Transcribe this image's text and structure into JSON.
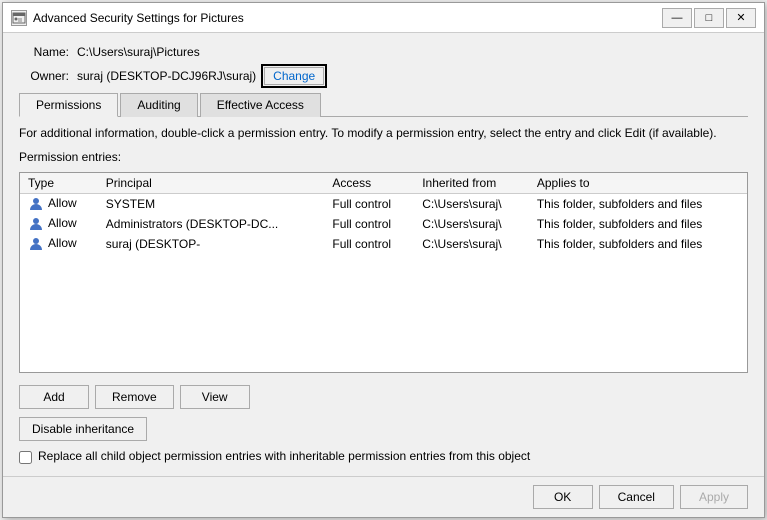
{
  "window": {
    "title": "Advanced Security Settings for Pictures",
    "icon": "🔒"
  },
  "title_buttons": {
    "minimize": "—",
    "maximize": "□",
    "close": "✕"
  },
  "info": {
    "name_label": "Name:",
    "name_value": "C:\\Users\\suraj\\Pictures",
    "owner_label": "Owner:",
    "owner_value": "suraj (DESKTOP-DCJ96RJ\\suraj)",
    "change_label": "Change"
  },
  "tabs": [
    {
      "id": "permissions",
      "label": "Permissions",
      "active": true
    },
    {
      "id": "auditing",
      "label": "Auditing",
      "active": false
    },
    {
      "id": "effective_access",
      "label": "Effective Access",
      "active": false
    }
  ],
  "instruction": "For additional information, double-click a permission entry. To modify a permission entry, select the entry and click Edit (if available).",
  "section_label": "Permission entries:",
  "table": {
    "columns": [
      "Type",
      "Principal",
      "Access",
      "Inherited from",
      "Applies to"
    ],
    "rows": [
      {
        "type": "Allow",
        "principal": "SYSTEM",
        "access": "Full control",
        "inherited_from": "C:\\Users\\suraj\\",
        "applies_to": "This folder, subfolders and files"
      },
      {
        "type": "Allow",
        "principal": "Administrators (DESKTOP-DC...",
        "access": "Full control",
        "inherited_from": "C:\\Users\\suraj\\",
        "applies_to": "This folder, subfolders and files"
      },
      {
        "type": "Allow",
        "principal": "suraj (DESKTOP-",
        "access": "Full control",
        "inherited_from": "C:\\Users\\suraj\\",
        "applies_to": "This folder, subfolders and files"
      }
    ]
  },
  "buttons": {
    "add": "Add",
    "remove": "Remove",
    "view": "View",
    "disable_inheritance": "Disable inheritance"
  },
  "checkbox": {
    "label": "Replace all child object permission entries with inheritable permission entries from this object"
  },
  "footer": {
    "ok": "OK",
    "cancel": "Cancel",
    "apply": "Apply"
  }
}
